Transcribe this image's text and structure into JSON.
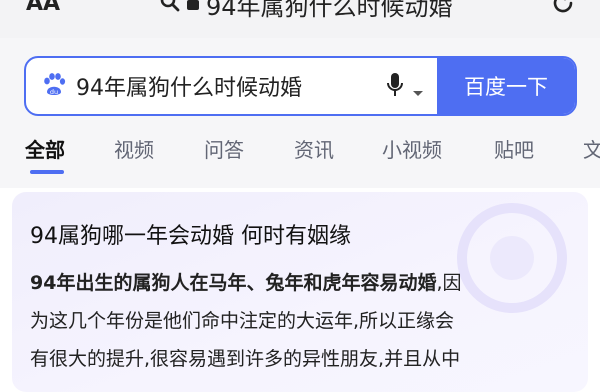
{
  "browser": {
    "text_size_button": "AA",
    "url_text": "94年属狗什么时候动婚",
    "icons": [
      "search-icon",
      "lock-icon",
      "reload-icon"
    ]
  },
  "search": {
    "query": "94年属狗什么时候动婚",
    "submit_label": "百度一下",
    "icons": [
      "baidu-paw-icon",
      "microphone-icon",
      "chevron-down-icon"
    ],
    "accent_color": "#4e6ef2"
  },
  "tabs": [
    {
      "label": "全部",
      "active": true
    },
    {
      "label": "视频",
      "active": false
    },
    {
      "label": "问答",
      "active": false
    },
    {
      "label": "资讯",
      "active": false
    },
    {
      "label": "小视频",
      "active": false
    },
    {
      "label": "贴吧",
      "active": false
    },
    {
      "label": "文",
      "active": false
    }
  ],
  "result": {
    "title": "94属狗哪一年会动婚 何时有姻缘",
    "lines": [
      "94年出生的属狗人在马年、兔年和虎年容易动婚,因",
      "为这几个年份是他们命中注定的大运年,所以正缘会",
      "有很大的提升,很容易遇到许多的异性朋友,并且从中"
    ],
    "emphasis": "94年出生的属狗人在马年、兔年和虎年容易动婚"
  }
}
